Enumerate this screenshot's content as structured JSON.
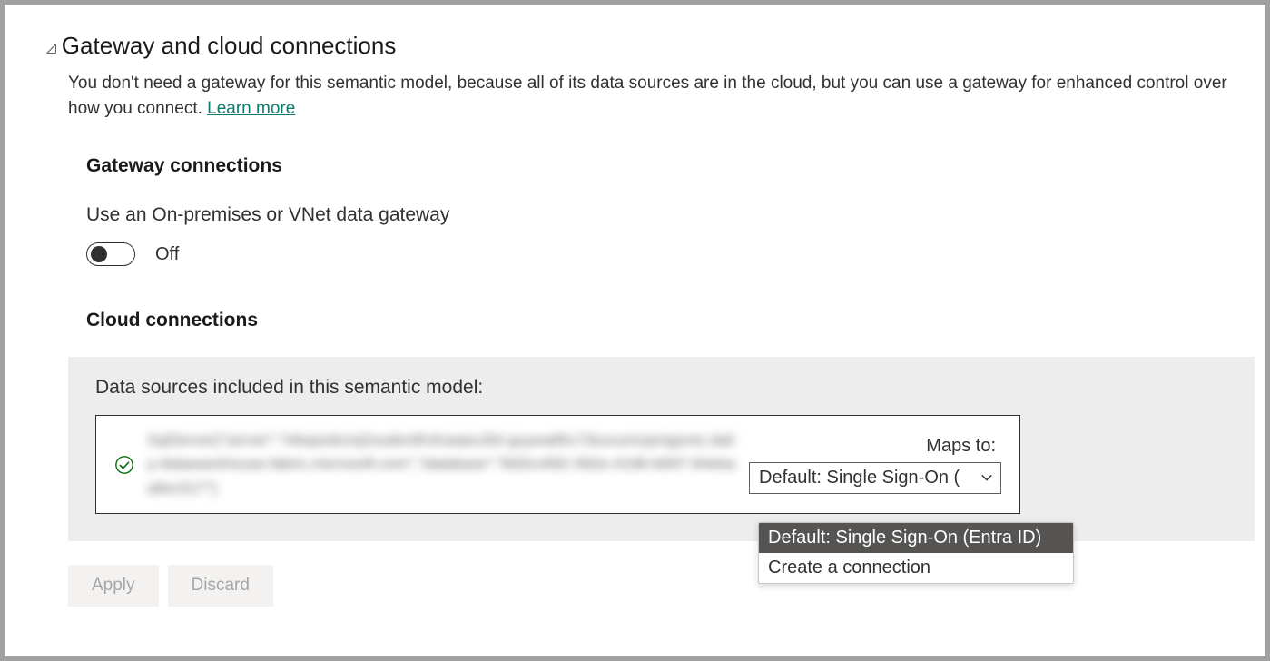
{
  "section": {
    "title": "Gateway and cloud connections",
    "description_before": "You don't need a gateway for this semantic model, because all of its data sources are in the cloud, but you can use a gateway for enhanced control over how you connect. ",
    "learn_more": "Learn more"
  },
  "gateway": {
    "title": "Gateway connections",
    "toggle_label": "Use an On-premises or VNet data gateway",
    "toggle_state": "Off"
  },
  "cloud": {
    "title": "Cloud connections",
    "panel_title": "Data sources included in this semantic model:",
    "blurred": "SqlServer{\"server\":\"n6wpodcmj2oudentfn4naaeu3t4-guywa8hc7duxuxmzpnigovtz.daily-datawarehouse.fabric.microsoft.com\",\"database\":\"8d3cc692-392e-4196-b697-84ebaa6ec517\"}",
    "maps_to_label": "Maps to:",
    "dropdown_selected": "Default: Single Sign-On (",
    "options": {
      "opt1": "Default: Single Sign-On (Entra ID)",
      "opt2": "Create a connection"
    }
  },
  "buttons": {
    "apply": "Apply",
    "discard": "Discard"
  }
}
